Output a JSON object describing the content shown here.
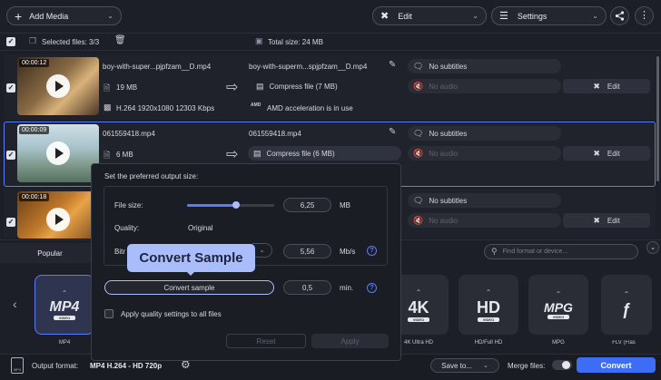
{
  "toolbar": {
    "add_media": "Add Media",
    "edit": "Edit",
    "settings": "Settings"
  },
  "selection": {
    "selected_label": "Selected files: 3/3",
    "total_size": "Total size: 24 MB"
  },
  "files": [
    {
      "duration": "00:00:12",
      "name": "boy-with-super...pjpfzam__D.mp4",
      "output_name": "boy-with-superm...spjpfzam__D.mp4",
      "size": "19 MB",
      "details": "H.264 1920x1080 12303 Kbps",
      "compress": "Compress file (7 MB)",
      "subtitles": "No subtitles",
      "audio": "No audio",
      "amd": "AMD acceleration is in use",
      "edit": "Edit"
    },
    {
      "duration": "00:00:09",
      "name": "061559418.mp4",
      "output_name": "061559418.mp4",
      "size": "6 MB",
      "compress": "Compress file (6 MB)",
      "subtitles": "No subtitles",
      "audio": "No audio",
      "edit": "Edit"
    },
    {
      "duration": "00:00:18",
      "subtitles": "No subtitles",
      "audio": "No audio",
      "edit": "Edit"
    }
  ],
  "popup": {
    "heading": "Set the preferred output size:",
    "file_size_label": "File size:",
    "file_size_value": "6,25",
    "file_size_unit": "MB",
    "file_size_slider_fraction": 0.56,
    "quality_label": "Quality:",
    "quality_value": "Original",
    "bitrate_label": "Bitr",
    "bitrate_value": "5,56",
    "bitrate_unit": "Mb/s",
    "tooltip": "Convert Sample",
    "convert_sample": "Convert sample",
    "sample_value": "0,5",
    "sample_unit": "min.",
    "apply_all": "Apply quality settings to all files",
    "reset": "Reset",
    "apply": "Apply"
  },
  "format_panel": {
    "tab_popular": "Popular",
    "search_placeholder": "Find format or device...",
    "formats": [
      {
        "icon": "MP4",
        "sub": "VIDEO",
        "label": "MP4"
      },
      {
        "icon": "4K",
        "sub": "VIDEO",
        "label": "4K Ultra HD"
      },
      {
        "icon": "HD",
        "sub": "VIDEO",
        "label": "HD/Full HD"
      },
      {
        "icon": "MPG",
        "sub": "VIDEO",
        "label": "MPG"
      },
      {
        "icon": "FLV",
        "sub": "",
        "label": "FLV (Flas"
      }
    ]
  },
  "footer": {
    "output_format_label": "Output format:",
    "output_format_value": "MP4 H.264 - HD 720p",
    "save_to": "Save to...",
    "merge_files": "Merge files:",
    "convert": "Convert"
  },
  "colors": {
    "accent": "#3d6cf5",
    "tooltip": "#a9bdfb",
    "background": "#1c1f27"
  }
}
